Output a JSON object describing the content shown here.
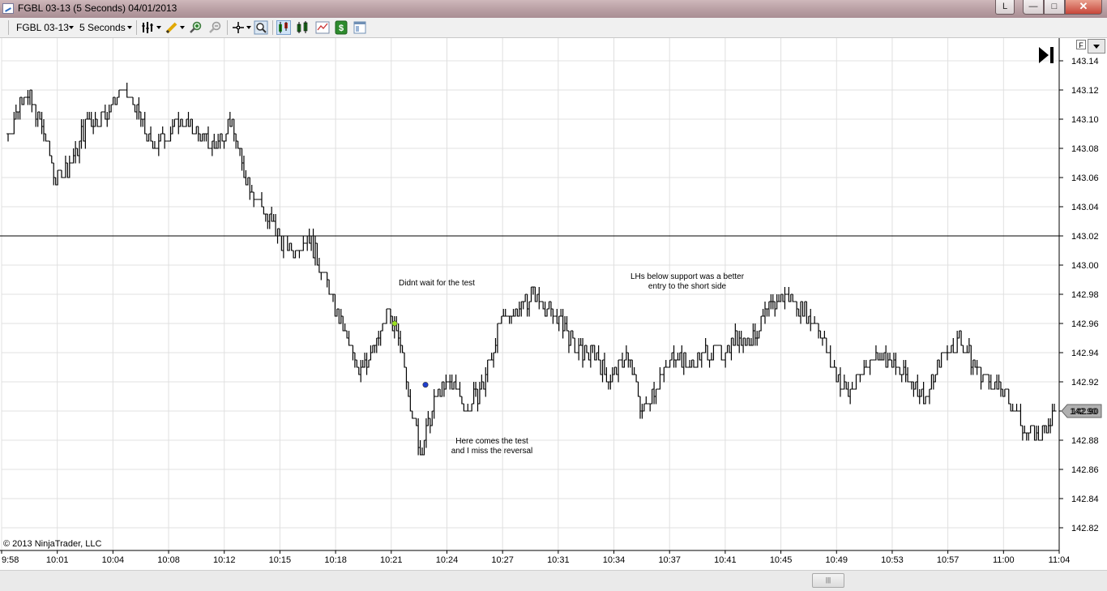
{
  "window": {
    "title": "FGBL 03-13 (5 Seconds)  04/01/2013",
    "buttons": {
      "link": "L",
      "minimize": "—",
      "maximize": "□",
      "close": "✕"
    }
  },
  "toolbar": {
    "instrument": "FGBL 03-13",
    "interval": "5 Seconds",
    "icons": [
      "bar-style-icon",
      "drawing-pencil-icon",
      "zoom-in-icon",
      "zoom-out-icon",
      "crosshair-icon",
      "magnifier-icon",
      "chart-trader-icon",
      "indicators-icon",
      "strategies-icon",
      "dollar-icon",
      "properties-icon"
    ]
  },
  "chart": {
    "copyright": "© 2013 NinjaTrader, LLC",
    "f_label": "F",
    "scrollbar_grip": "|||",
    "last_price_label": "142.90",
    "price_ticks": [
      "143.14",
      "143.12",
      "143.10",
      "143.08",
      "143.06",
      "143.04",
      "143.02",
      "143.00",
      "142.98",
      "142.96",
      "142.94",
      "142.92",
      "142.90",
      "142.88",
      "142.86",
      "142.84",
      "142.82"
    ],
    "time_ticks": [
      "9:58",
      "10:01",
      "10:04",
      "10:08",
      "10:12",
      "10:15",
      "10:18",
      "10:21",
      "10:24",
      "10:27",
      "10:31",
      "10:34",
      "10:37",
      "10:41",
      "10:45",
      "10:49",
      "10:53",
      "10:57",
      "11:00",
      "11:04"
    ],
    "annotations": [
      {
        "lines": [
          "Didnt wait for the test"
        ]
      },
      {
        "lines": [
          "Here comes the test",
          "and I miss the reversal"
        ]
      },
      {
        "lines": [
          "LHs below support was a better",
          "entry to the short side"
        ]
      }
    ],
    "support_level": 143.02,
    "markers": [
      {
        "price": 142.96,
        "color": "#9be020"
      },
      {
        "price": 142.918,
        "color": "#1f3fcf"
      }
    ],
    "colors": {
      "bars": "#000000",
      "grid": "#e0e0e0",
      "support_line": "#000000"
    }
  },
  "chart_data": {
    "type": "line",
    "ylim": [
      142.81,
      143.15
    ],
    "x": [
      "9:58",
      "9:59",
      "10:00",
      "10:01",
      "10:02",
      "10:03",
      "10:04",
      "10:05",
      "10:06",
      "10:07",
      "10:08",
      "10:09",
      "10:10",
      "10:11",
      "10:12",
      "10:13",
      "10:14",
      "10:15",
      "10:16",
      "10:17",
      "10:18",
      "10:19",
      "10:20",
      "10:21",
      "10:22",
      "10:23",
      "10:24",
      "10:25",
      "10:26",
      "10:27",
      "10:28",
      "10:29",
      "10:30",
      "10:31",
      "10:32",
      "10:33",
      "10:34",
      "10:35",
      "10:36",
      "10:37",
      "10:38",
      "10:39",
      "10:40",
      "10:41",
      "10:42",
      "10:43",
      "10:44",
      "10:45",
      "10:46",
      "10:47",
      "10:48",
      "10:49",
      "10:50",
      "10:51",
      "10:52",
      "10:53",
      "10:54",
      "10:55",
      "10:56",
      "10:57",
      "10:58",
      "10:59",
      "11:00",
      "11:01",
      "11:02",
      "11:03",
      "11:04"
    ],
    "series": [
      {
        "values": [
          143.09,
          143.12,
          143.1,
          143.06,
          143.07,
          143.1,
          143.1,
          143.12,
          143.11,
          143.08,
          143.09,
          143.1,
          143.09,
          143.08,
          143.1,
          143.06,
          143.04,
          143.02,
          143.01,
          143.02,
          142.99,
          142.96,
          142.93,
          142.94,
          142.97,
          142.93,
          142.87,
          142.91,
          142.92,
          142.9,
          142.92,
          142.96,
          142.97,
          142.98,
          142.97,
          142.96,
          142.94,
          142.94,
          142.92,
          142.94,
          142.9,
          142.92,
          142.94,
          142.93,
          142.94,
          142.94,
          142.95,
          142.95,
          142.97,
          142.98,
          142.97,
          142.96,
          142.93,
          142.91,
          142.93,
          142.94,
          142.93,
          142.92,
          142.91,
          142.94,
          142.95,
          142.93,
          142.92,
          142.91,
          142.89,
          142.88,
          142.9
        ]
      }
    ]
  }
}
